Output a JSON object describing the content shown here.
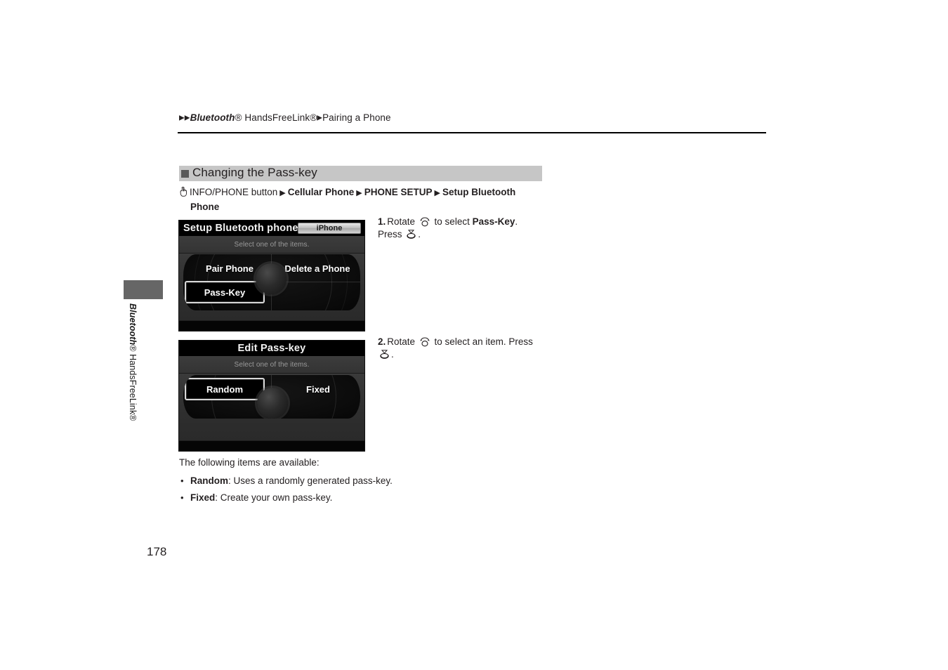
{
  "breadcrumb": {
    "marker": "▶",
    "part1": "Bluetooth",
    "part1_reg": "® HandsFreeLink®",
    "part2": "Pairing a Phone"
  },
  "side_tab": {
    "label_italic": "Bluetooth",
    "label_rest": "® HandsFreeLink®"
  },
  "section": {
    "header_title": "Changing the Pass-key",
    "nav_icon": "hand-press-icon",
    "nav_button": "INFO/PHONE button",
    "nav_arrow": "▶",
    "nav_step1": "Cellular Phone",
    "nav_step2": "PHONE SETUP",
    "nav_step3": "Setup Bluetooth",
    "nav_step3_cont": "Phone"
  },
  "nav_screens": [
    {
      "title": "Setup Bluetooth phone",
      "badge": "iPhone",
      "subtitle": "Select one of the items.",
      "items": [
        {
          "label": "Pair Phone",
          "selected": false
        },
        {
          "label": "Delete a Phone",
          "selected": false
        },
        {
          "label": "Pass-Key",
          "selected": true
        }
      ]
    },
    {
      "title": "Edit Pass-key",
      "badge": "",
      "subtitle": "Select one of the items.",
      "items": [
        {
          "label": "Random",
          "selected": true
        },
        {
          "label": "Fixed",
          "selected": false
        }
      ]
    }
  ],
  "steps": [
    {
      "number": "1.",
      "text_a": "Rotate ",
      "rotate_icon": "rotate-knob-icon",
      "text_b": " to select ",
      "bold": "Pass-Key",
      "text_c": ".",
      "text_d": "Press ",
      "press_icon": "press-knob-icon",
      "text_e": "."
    },
    {
      "number": "2.",
      "text_a": "Rotate ",
      "rotate_icon": "rotate-knob-icon",
      "text_b": " to select an item. Press",
      "press_icon": "press-knob-icon",
      "text_e": "."
    }
  ],
  "body": {
    "lead": "The following items are available:",
    "bullets": [
      {
        "term": "Random",
        "desc": ": Uses a randomly generated pass-key."
      },
      {
        "term": "Fixed",
        "desc": ": Create your own pass-key."
      }
    ]
  },
  "page_number": "178",
  "colors": {
    "header_bar": "#c6c6c6",
    "side_tab": "#666666",
    "text": "#231f20"
  }
}
